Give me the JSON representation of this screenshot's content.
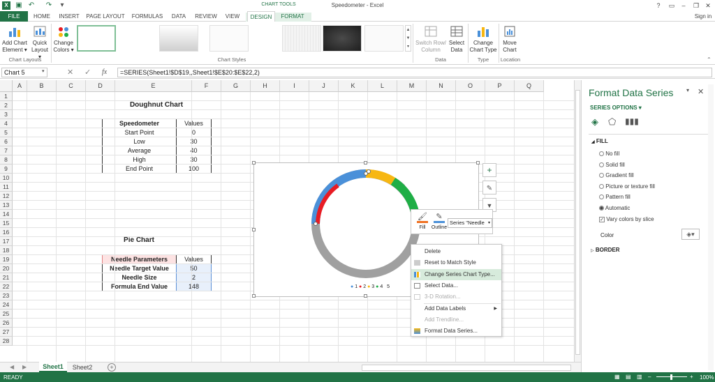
{
  "window": {
    "title": "Speedometer - Excel",
    "sign_in": "Sign in"
  },
  "tabs": {
    "file": "FILE",
    "home": "HOME",
    "insert": "INSERT",
    "page_layout": "PAGE LAYOUT",
    "formulas": "FORMULAS",
    "data": "DATA",
    "review": "REVIEW",
    "view": "VIEW",
    "context_label": "CHART TOOLS",
    "design": "DESIGN",
    "format": "FORMAT"
  },
  "ribbon": {
    "add_chart_element": [
      "Add Chart",
      "Element ▾"
    ],
    "quick_layout": [
      "Quick",
      "Layout ▾"
    ],
    "change_colors": [
      "Change",
      "Colors ▾"
    ],
    "switch_row_col": [
      "Switch Row/",
      "Column"
    ],
    "select_data": [
      "Select",
      "Data"
    ],
    "change_chart_type": [
      "Change",
      "Chart Type"
    ],
    "move_chart": [
      "Move",
      "Chart"
    ],
    "groups": {
      "chart_layouts": "Chart Layouts",
      "chart_styles": "Chart Styles",
      "data": "Data",
      "type": "Type",
      "location": "Location"
    }
  },
  "formula_bar": {
    "name_box": "Chart 5",
    "fx": "fx",
    "formula": "=SERIES(Sheet1!$D$19,,Sheet1!$E$20:$E$22,2)"
  },
  "columns": [
    "A",
    "B",
    "C",
    "D",
    "E",
    "F",
    "G",
    "H",
    "I",
    "J",
    "K",
    "L",
    "M",
    "N",
    "O",
    "P",
    "Q"
  ],
  "rows": [
    "1",
    "2",
    "3",
    "4",
    "5",
    "6",
    "7",
    "8",
    "9",
    "10",
    "11",
    "12",
    "13",
    "14",
    "15",
    "16",
    "17",
    "18",
    "19",
    "20",
    "21",
    "22",
    "23",
    "24",
    "25",
    "26",
    "27",
    "28"
  ],
  "doughnut": {
    "title": "Doughnut Chart",
    "headers": [
      "Speedometer",
      "Values"
    ],
    "rows": [
      [
        "Start Point",
        "0"
      ],
      [
        "Low",
        "30"
      ],
      [
        "Average",
        "40"
      ],
      [
        "High",
        "30"
      ],
      [
        "End Point",
        "100"
      ]
    ]
  },
  "pie": {
    "title": "Pie Chart",
    "headers": [
      "Needle Parameters",
      "Values"
    ],
    "rows": [
      [
        "Needle Target Value",
        "50"
      ],
      [
        "Needle Size",
        "2"
      ],
      [
        "Formula End Value",
        "148"
      ]
    ]
  },
  "chart": {
    "legend": [
      "1",
      "2",
      "3",
      "4",
      "5"
    ],
    "colors": {
      "red": "#e81c24",
      "blue": "#4a90d9",
      "yellow": "#f7b712",
      "green": "#1fae46",
      "gray": "#a0a0a0"
    }
  },
  "mini_toolbar": {
    "fill": "Fill",
    "outline": "Outline",
    "series_select": "Series \"Needle"
  },
  "context_menu": [
    {
      "label": "Delete",
      "disabled": false
    },
    {
      "label": "Reset to Match Style",
      "disabled": false
    },
    {
      "label": "Change Series Chart Type...",
      "disabled": false,
      "highlight": true
    },
    {
      "label": "Select Data...",
      "disabled": false
    },
    {
      "label": "3-D Rotation...",
      "disabled": true
    },
    {
      "label": "Add Data Labels",
      "disabled": false
    },
    {
      "label": "Add Trendline...",
      "disabled": true
    },
    {
      "label": "Format Data Series...",
      "disabled": false
    }
  ],
  "pane": {
    "title": "Format Data Series",
    "series_options": "SERIES OPTIONS ▾",
    "fill_section": "FILL",
    "options": [
      "No fill",
      "Solid fill",
      "Gradient fill",
      "Picture or texture fill",
      "Pattern fill",
      "Automatic"
    ],
    "selected_option": "Automatic",
    "vary_colors": "Vary colors by slice",
    "color_label": "Color",
    "border_section": "BORDER"
  },
  "sheets": [
    "Sheet1",
    "Sheet2"
  ],
  "status": {
    "left": "READY",
    "zoom": "100%"
  }
}
